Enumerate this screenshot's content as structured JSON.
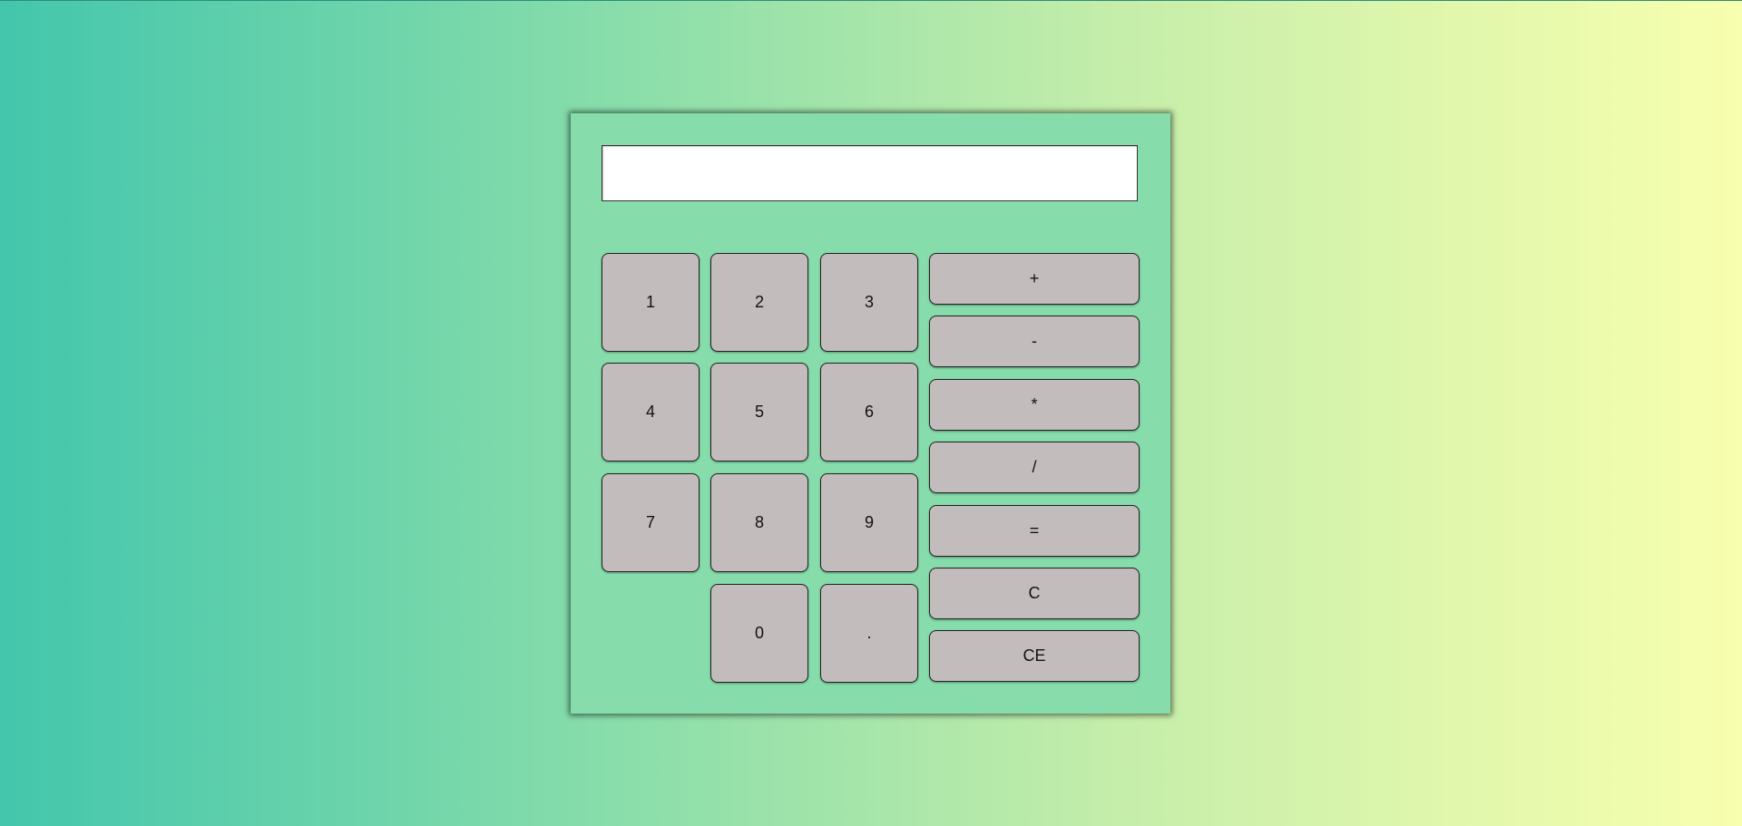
{
  "calculator": {
    "display": {
      "value": ""
    },
    "digits": {
      "one": "1",
      "two": "2",
      "three": "3",
      "four": "4",
      "five": "5",
      "six": "6",
      "seven": "7",
      "eight": "8",
      "nine": "9",
      "zero": "0",
      "decimal": "."
    },
    "operators": {
      "plus": "+",
      "minus": "-",
      "multiply": "*",
      "divide": "/",
      "equals": "=",
      "clear": "C",
      "clear_entry": "CE"
    }
  },
  "colors": {
    "background_start": "#43c6ac",
    "background_end": "#f8ffae",
    "panel": "#86dcab",
    "button": "#c3bcbc",
    "display": "#ffffff"
  }
}
